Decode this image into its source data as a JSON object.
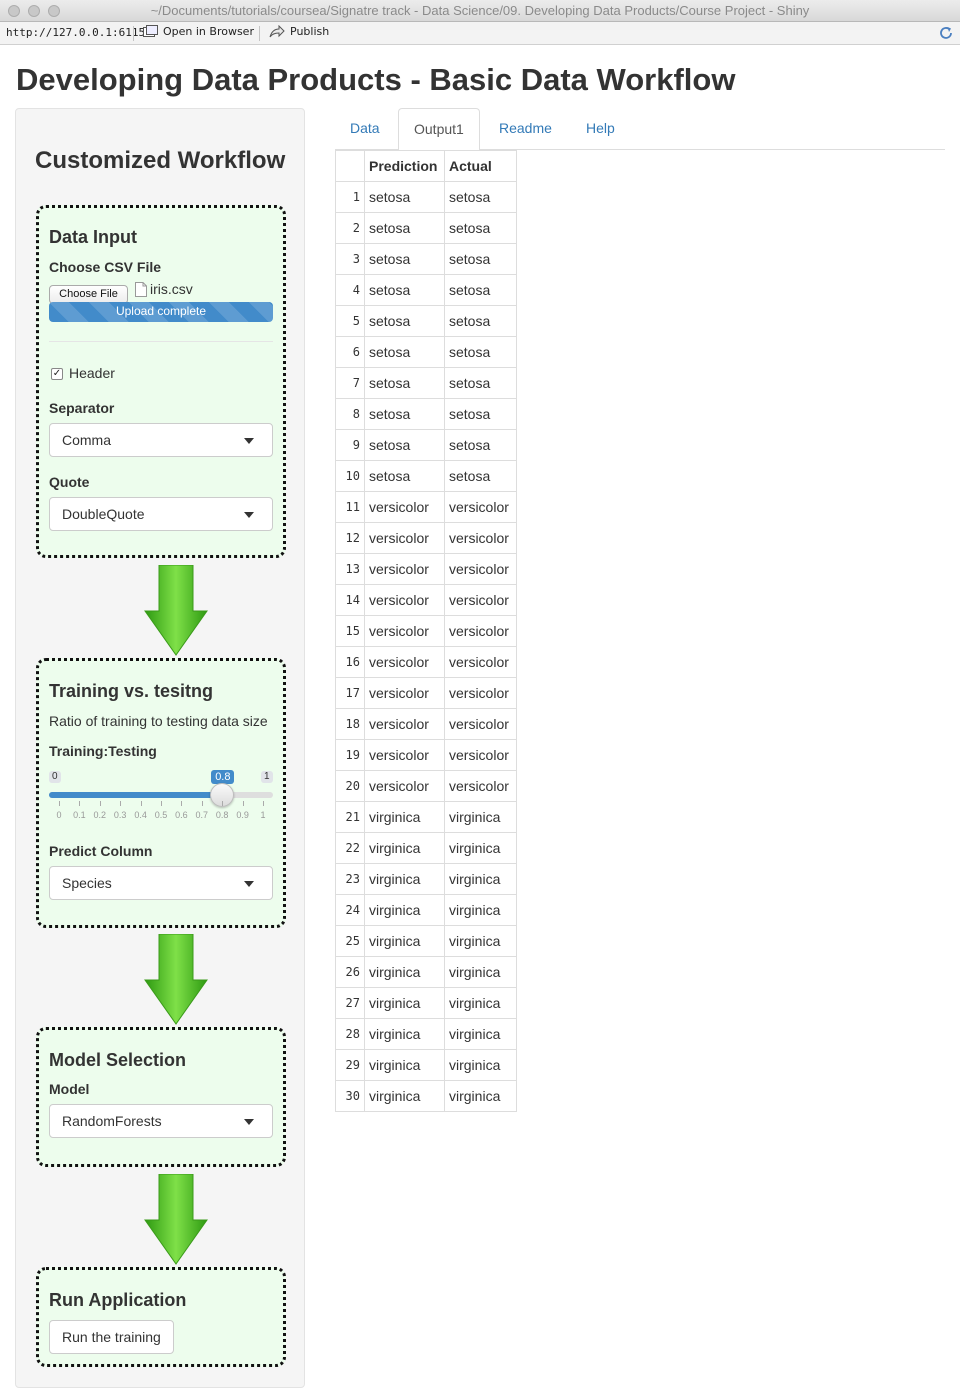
{
  "window": {
    "title": "~/Documents/tutorials/coursea/Signatre track - Data Science/09. Developing Data Products/Course Project - Shiny"
  },
  "address_bar": {
    "url": "http://127.0.0.1:6115",
    "open_in_browser_label": "Open in Browser",
    "publish_label": "Publish"
  },
  "page": {
    "title": "Developing Data Products - Basic Data Workflow"
  },
  "sidebar": {
    "title": "Customized Workflow",
    "data_input": {
      "heading": "Data Input",
      "file_label": "Choose CSV File",
      "file_button_label": "Choose File",
      "file_name": "iris.csv",
      "progress_text": "Upload complete",
      "progress_percent": 100,
      "header_label": "Header",
      "header_checked": true,
      "header_check_mark": "✓",
      "separator_label": "Separator",
      "separator_value": "Comma",
      "quote_label": "Quote",
      "quote_value": "DoubleQuote"
    },
    "training": {
      "heading": "Training vs. tesitng",
      "description": "Ratio of training to testing data size",
      "slider_label": "Training:Testing",
      "slider_min": "0",
      "slider_max": "1",
      "slider_value": 0.8,
      "slider_value_label": "0.8",
      "ticks": [
        "0",
        "0.1",
        "0.2",
        "0.3",
        "0.4",
        "0.5",
        "0.6",
        "0.7",
        "0.8",
        "0.9",
        "1"
      ],
      "predict_label": "Predict Column",
      "predict_value": "Species"
    },
    "model": {
      "heading": "Model Selection",
      "model_label": "Model",
      "model_value": "RandomForests"
    },
    "run": {
      "heading": "Run Application",
      "button_label": "Run the training"
    }
  },
  "tabs": [
    {
      "label": "Data",
      "active": false
    },
    {
      "label": "Output1",
      "active": true
    },
    {
      "label": "Readme",
      "active": false
    },
    {
      "label": "Help",
      "active": false
    }
  ],
  "table": {
    "columns": [
      "",
      "Prediction",
      "Actual"
    ],
    "rows": [
      [
        "1",
        "setosa",
        "setosa"
      ],
      [
        "2",
        "setosa",
        "setosa"
      ],
      [
        "3",
        "setosa",
        "setosa"
      ],
      [
        "4",
        "setosa",
        "setosa"
      ],
      [
        "5",
        "setosa",
        "setosa"
      ],
      [
        "6",
        "setosa",
        "setosa"
      ],
      [
        "7",
        "setosa",
        "setosa"
      ],
      [
        "8",
        "setosa",
        "setosa"
      ],
      [
        "9",
        "setosa",
        "setosa"
      ],
      [
        "10",
        "setosa",
        "setosa"
      ],
      [
        "11",
        "versicolor",
        "versicolor"
      ],
      [
        "12",
        "versicolor",
        "versicolor"
      ],
      [
        "13",
        "versicolor",
        "versicolor"
      ],
      [
        "14",
        "versicolor",
        "versicolor"
      ],
      [
        "15",
        "versicolor",
        "versicolor"
      ],
      [
        "16",
        "versicolor",
        "versicolor"
      ],
      [
        "17",
        "versicolor",
        "versicolor"
      ],
      [
        "18",
        "versicolor",
        "versicolor"
      ],
      [
        "19",
        "versicolor",
        "versicolor"
      ],
      [
        "20",
        "versicolor",
        "versicolor"
      ],
      [
        "21",
        "virginica",
        "virginica"
      ],
      [
        "22",
        "virginica",
        "virginica"
      ],
      [
        "23",
        "virginica",
        "virginica"
      ],
      [
        "24",
        "virginica",
        "virginica"
      ],
      [
        "25",
        "virginica",
        "virginica"
      ],
      [
        "26",
        "virginica",
        "virginica"
      ],
      [
        "27",
        "virginica",
        "virginica"
      ],
      [
        "28",
        "virginica",
        "virginica"
      ],
      [
        "29",
        "virginica",
        "virginica"
      ],
      [
        "30",
        "virginica",
        "virginica"
      ]
    ]
  },
  "colors": {
    "panel_background": "#edfded",
    "accent": "#428bca",
    "link": "#337ab7",
    "arrow_green": "#3fb51f"
  },
  "icons": {
    "window_controls": "traffic-light-icons",
    "open_in_browser": "browser-window-icon",
    "publish": "publish-arrow-icon",
    "refresh": "refresh-icon",
    "file": "document-icon",
    "caret": "caret-down-icon",
    "flow_arrow": "green-down-arrow-icon"
  }
}
